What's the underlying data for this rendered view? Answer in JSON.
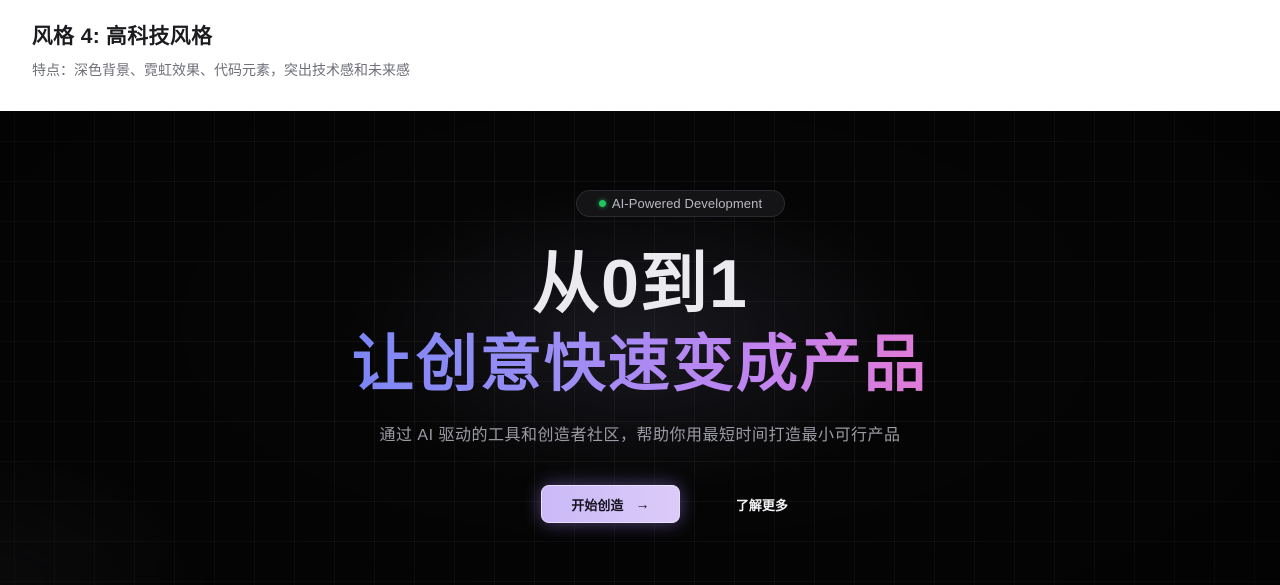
{
  "header": {
    "title": "风格 4: 高科技风格",
    "subtitle": "特点：深色背景、霓虹效果、代码元素，突出技术感和未来感"
  },
  "hero": {
    "badge": {
      "text": "AI-Powered Development",
      "dot_color": "#22c55e"
    },
    "title_line1": "从0到1",
    "title_line2": "让创意快速变成产品",
    "description": "通过 AI 驱动的工具和创造者社区，帮助你用最短时间打造最小可行产品",
    "primary_button": {
      "label": "开始创造",
      "icon": "arrow-right-icon"
    },
    "secondary_button": {
      "label": "了解更多"
    }
  },
  "colors": {
    "background": "#050505",
    "gradient_start": "#7c86f5",
    "gradient_end": "#e07ad6",
    "primary_button": "#d2c3f8",
    "accent_dot": "#22c55e"
  }
}
